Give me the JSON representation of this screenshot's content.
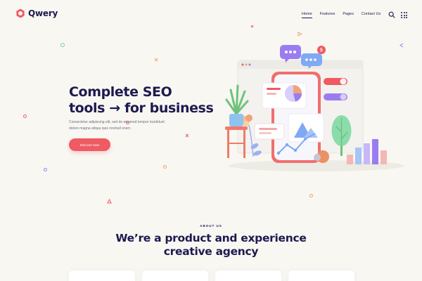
{
  "brand": {
    "name": "Qwery",
    "color": "#ef5a63"
  },
  "nav": {
    "items": [
      {
        "label": "Home",
        "active": true
      },
      {
        "label": "Features",
        "active": false
      },
      {
        "label": "Pages",
        "active": false
      },
      {
        "label": "Contact Us",
        "active": false
      }
    ],
    "search_icon": "search-icon",
    "menu_icon": "grid-menu-icon"
  },
  "hero": {
    "title_line1": "Complete SEO",
    "title_line2": "tools → for business",
    "desc_line1": "Consectetur adipiscing elit, sed do eiusmod tempor incididunt",
    "desc_line2": "dolore magna aliqua quis nostrud exerc.",
    "cta_label": "Discover Now",
    "notification_count": "5"
  },
  "about": {
    "eyebrow": "ABOUT US",
    "title_line1": "We’re a product and experience",
    "title_line2": "creative agency"
  },
  "colors": {
    "navy": "#1c1a4e",
    "accent": "#ef5a63",
    "background": "#f8f7f2",
    "purple": "#9b7cf0",
    "green": "#6fd3a0",
    "blue": "#7fa8f5"
  }
}
